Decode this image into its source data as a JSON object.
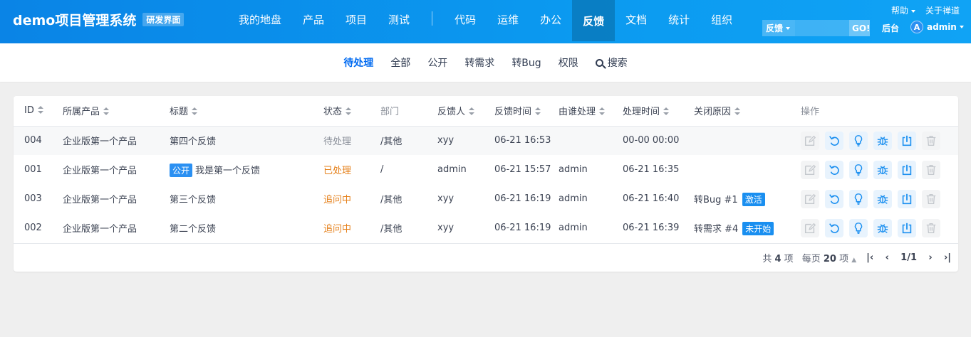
{
  "header": {
    "brand": "demo项目管理系统",
    "brand_tag": "研发界面",
    "nav": [
      {
        "label": "我的地盘"
      },
      {
        "label": "产品"
      },
      {
        "label": "项目"
      },
      {
        "label": "测试"
      },
      {
        "label": "代码"
      },
      {
        "label": "运维"
      },
      {
        "label": "办公"
      },
      {
        "label": "反馈",
        "active": true
      },
      {
        "label": "文档"
      },
      {
        "label": "统计"
      },
      {
        "label": "组织"
      }
    ],
    "help": "帮助",
    "about": "关于禅道",
    "search_type": "反馈",
    "search_placeholder": "",
    "search_go": "GO!",
    "admin_link": "后台",
    "avatar_letter": "A",
    "user_name": "admin"
  },
  "subnav": {
    "items": [
      {
        "label": "待处理",
        "active": true
      },
      {
        "label": "全部"
      },
      {
        "label": "公开"
      },
      {
        "label": "转需求"
      },
      {
        "label": "转Bug"
      },
      {
        "label": "权限"
      }
    ],
    "search": "搜索"
  },
  "table": {
    "columns": [
      "ID",
      "所属产品",
      "标题",
      "状态",
      "部门",
      "反馈人",
      "反馈时间",
      "由谁处理",
      "处理时间",
      "关闭原因",
      "操作"
    ],
    "rows": [
      {
        "id": "004",
        "product": "企业版第一个产品",
        "tag": "",
        "title": "第四个反馈",
        "status": "待处理",
        "dept": "/其他",
        "reporter": "xyy",
        "time": "06-21 16:53",
        "handler": "",
        "handled_time": "00-00 00:00",
        "close_reason": "",
        "close_badge": ""
      },
      {
        "id": "001",
        "product": "企业版第一个产品",
        "tag": "公开",
        "title": "我是第一个反馈",
        "status": "已处理",
        "dept": "/",
        "reporter": "admin",
        "time": "06-21 15:57",
        "handler": "admin",
        "handled_time": "06-21 16:35",
        "close_reason": "",
        "close_badge": ""
      },
      {
        "id": "003",
        "product": "企业版第一个产品",
        "tag": "",
        "title": "第三个反馈",
        "status": "追问中",
        "dept": "/其他",
        "reporter": "xyy",
        "time": "06-21 16:19",
        "handler": "admin",
        "handled_time": "06-21 16:40",
        "close_reason": "转Bug #1",
        "close_badge": "激活"
      },
      {
        "id": "002",
        "product": "企业版第一个产品",
        "tag": "",
        "title": "第二个反馈",
        "status": "追问中",
        "dept": "/其他",
        "reporter": "xyy",
        "time": "06-21 16:19",
        "handler": "admin",
        "handled_time": "06-21 16:39",
        "close_reason": "转需求 #4",
        "close_badge": "未开始"
      }
    ]
  },
  "footer": {
    "total_prefix": "共",
    "total": "4",
    "total_suffix": "项",
    "per_page_prefix": "每页",
    "per_page": "20",
    "per_page_suffix": "项",
    "page": "1/1"
  },
  "colors": {
    "accent": "#006af1",
    "status_pending": "#8a8f99",
    "status_orange": "#e5801a",
    "badge": "#2b90f2"
  },
  "icons": [
    "edit-icon",
    "undo-icon",
    "lightbulb-icon",
    "bug-icon",
    "export-icon",
    "trash-icon"
  ]
}
